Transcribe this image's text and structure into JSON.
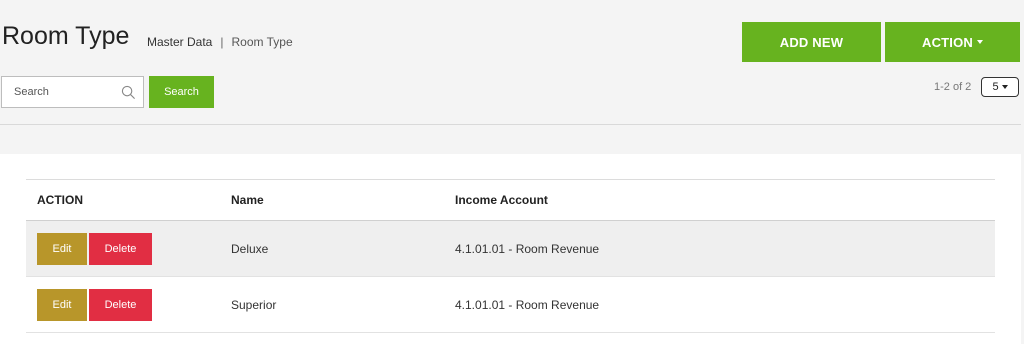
{
  "header": {
    "title": "Room Type",
    "breadcrumb": {
      "parent": "Master Data",
      "separator": "|",
      "current": "Room Type"
    },
    "add_new_label": "ADD NEW",
    "action_label": "ACTION"
  },
  "search": {
    "placeholder": "Search",
    "value": "",
    "button_label": "Search"
  },
  "pagination": {
    "range_text": "1-2 of 2",
    "page_size": "5"
  },
  "table": {
    "columns": [
      "ACTION",
      "Name",
      "Income Account"
    ],
    "rows": [
      {
        "name": "Deluxe",
        "income_account": "4.1.01.01 - Room Revenue",
        "edit_label": "Edit",
        "delete_label": "Delete"
      },
      {
        "name": "Superior",
        "income_account": "4.1.01.01 - Room Revenue",
        "edit_label": "Edit",
        "delete_label": "Delete"
      }
    ]
  },
  "colors": {
    "primary_green": "#67b31f",
    "edit_gold": "#b8962a",
    "delete_red": "#e12e43"
  }
}
